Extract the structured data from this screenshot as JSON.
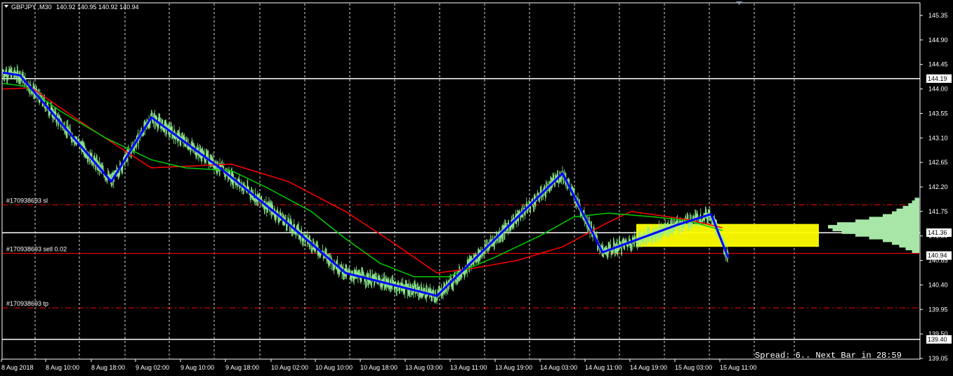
{
  "chart_data": {
    "type": "candlestick",
    "header": {
      "symbol": "GBPJPY",
      "timeframe": "M30",
      "ohlc": "140.92 140.95 140.92 140.94"
    },
    "y_axis": {
      "ticks": [
        "145.35",
        "144.90",
        "144.45",
        "144.00",
        "143.55",
        "143.10",
        "142.65",
        "142.20",
        "141.75",
        "141.30",
        "140.85",
        "140.40",
        "139.95",
        "139.50",
        "139.05"
      ],
      "tick_values": [
        145.35,
        144.9,
        144.45,
        144.0,
        143.55,
        143.1,
        142.65,
        142.2,
        141.75,
        141.3,
        140.85,
        140.4,
        139.95,
        139.5,
        139.05
      ],
      "range": [
        139.05,
        145.35
      ]
    },
    "x_axis": {
      "ticks": [
        "8 Aug 2018",
        "8 Aug 10:00",
        "8 Aug 18:00",
        "9 Aug 02:00",
        "9 Aug 10:00",
        "9 Aug 18:00",
        "10 Aug 02:00",
        "10 Aug 10:00",
        "10 Aug 18:00",
        "13 Aug 03:00",
        "13 Aug 11:00",
        "13 Aug 19:00",
        "14 Aug 03:00",
        "14 Aug 11:00",
        "14 Aug 19:00",
        "15 Aug 03:00",
        "15 Aug 11:00"
      ]
    },
    "price_tags": [
      {
        "name": "high-level-tag",
        "value": "144.19",
        "price": 144.19,
        "style": "white-box"
      },
      {
        "name": "mid-level-tag",
        "value": "141.36",
        "price": 141.36,
        "style": "white-box"
      },
      {
        "name": "current-price-tag",
        "value": "140.94",
        "price": 140.94,
        "style": "white-box"
      },
      {
        "name": "low-level-tag",
        "value": "139.40",
        "price": 139.4,
        "style": "white-box"
      }
    ],
    "horizontal_lines": [
      {
        "price": 144.19,
        "color": "#ffffff",
        "style": "solid"
      },
      {
        "price": 141.36,
        "color": "#ffffff",
        "style": "solid"
      },
      {
        "price": 139.4,
        "color": "#ffffff",
        "style": "solid"
      },
      {
        "price": 141.87,
        "color": "#ff0000",
        "style": "dashdot"
      },
      {
        "price": 140.98,
        "color": "#ff0000",
        "style": "solid"
      },
      {
        "price": 139.98,
        "color": "#ff0000",
        "style": "dashdot"
      }
    ],
    "order_labels": [
      {
        "text": "#170938693 sl",
        "price": 141.87
      },
      {
        "text": "#170938693 sell 0.02",
        "price": 140.98
      },
      {
        "text": "#170938693 tp",
        "price": 139.98
      }
    ],
    "zigzag": [
      {
        "i": 0,
        "p": 144.3
      },
      {
        "i": 30,
        "p": 144.25
      },
      {
        "i": 190,
        "p": 142.3
      },
      {
        "i": 260,
        "p": 143.48
      },
      {
        "i": 380,
        "p": 142.55
      },
      {
        "i": 480,
        "p": 141.7
      },
      {
        "i": 600,
        "p": 140.62
      },
      {
        "i": 760,
        "p": 140.2
      },
      {
        "i": 980,
        "p": 142.45
      },
      {
        "i": 1050,
        "p": 141.0
      },
      {
        "i": 1180,
        "p": 141.5
      },
      {
        "i": 1240,
        "p": 141.7
      },
      {
        "i": 1270,
        "p": 140.9
      }
    ],
    "ma_fast": [
      {
        "i": 0,
        "p": 144.1
      },
      {
        "i": 40,
        "p": 144.05
      },
      {
        "i": 100,
        "p": 143.6
      },
      {
        "i": 180,
        "p": 143.1
      },
      {
        "i": 260,
        "p": 142.7
      },
      {
        "i": 320,
        "p": 142.55
      },
      {
        "i": 400,
        "p": 142.5
      },
      {
        "i": 460,
        "p": 142.2
      },
      {
        "i": 540,
        "p": 141.75
      },
      {
        "i": 600,
        "p": 141.25
      },
      {
        "i": 660,
        "p": 140.8
      },
      {
        "i": 720,
        "p": 140.55
      },
      {
        "i": 780,
        "p": 140.55
      },
      {
        "i": 860,
        "p": 140.9
      },
      {
        "i": 940,
        "p": 141.3
      },
      {
        "i": 1000,
        "p": 141.65
      },
      {
        "i": 1060,
        "p": 141.72
      },
      {
        "i": 1140,
        "p": 141.65
      },
      {
        "i": 1200,
        "p": 141.58
      },
      {
        "i": 1260,
        "p": 141.4
      }
    ],
    "ma_slow": [
      {
        "i": 0,
        "p": 144.0
      },
      {
        "i": 50,
        "p": 144.02
      },
      {
        "i": 150,
        "p": 143.3
      },
      {
        "i": 260,
        "p": 142.55
      },
      {
        "i": 320,
        "p": 142.58
      },
      {
        "i": 400,
        "p": 142.62
      },
      {
        "i": 500,
        "p": 142.3
      },
      {
        "i": 600,
        "p": 141.75
      },
      {
        "i": 680,
        "p": 141.2
      },
      {
        "i": 760,
        "p": 140.62
      },
      {
        "i": 820,
        "p": 140.7
      },
      {
        "i": 900,
        "p": 140.85
      },
      {
        "i": 980,
        "p": 141.1
      },
      {
        "i": 1060,
        "p": 141.55
      },
      {
        "i": 1100,
        "p": 141.75
      },
      {
        "i": 1200,
        "p": 141.6
      },
      {
        "i": 1260,
        "p": 141.45
      }
    ],
    "volume_profile": {
      "levels": [
        141.95,
        141.9,
        141.85,
        141.8,
        141.75,
        141.7,
        141.65,
        141.6,
        141.55,
        141.5,
        141.45,
        141.4,
        141.35,
        141.3,
        141.25,
        141.2,
        141.15,
        141.1,
        141.05,
        141.0
      ],
      "sizes": [
        0.05,
        0.08,
        0.12,
        0.18,
        0.25,
        0.3,
        0.4,
        0.55,
        0.7,
        0.9,
        1.0,
        0.95,
        0.85,
        0.7,
        0.55,
        0.4,
        0.3,
        0.22,
        0.15,
        0.08
      ]
    },
    "spread_text": "Spread: 6.. Next Bar in 28:59",
    "colors": {
      "background": "#000000",
      "candle": "#90ee90",
      "zigzag": "#0000ff",
      "ma_fast": "#00cc00",
      "ma_slow": "#ff0000",
      "zone": "#ffff00",
      "profile": "#a8e6a8",
      "grid": "#ffffff"
    }
  }
}
